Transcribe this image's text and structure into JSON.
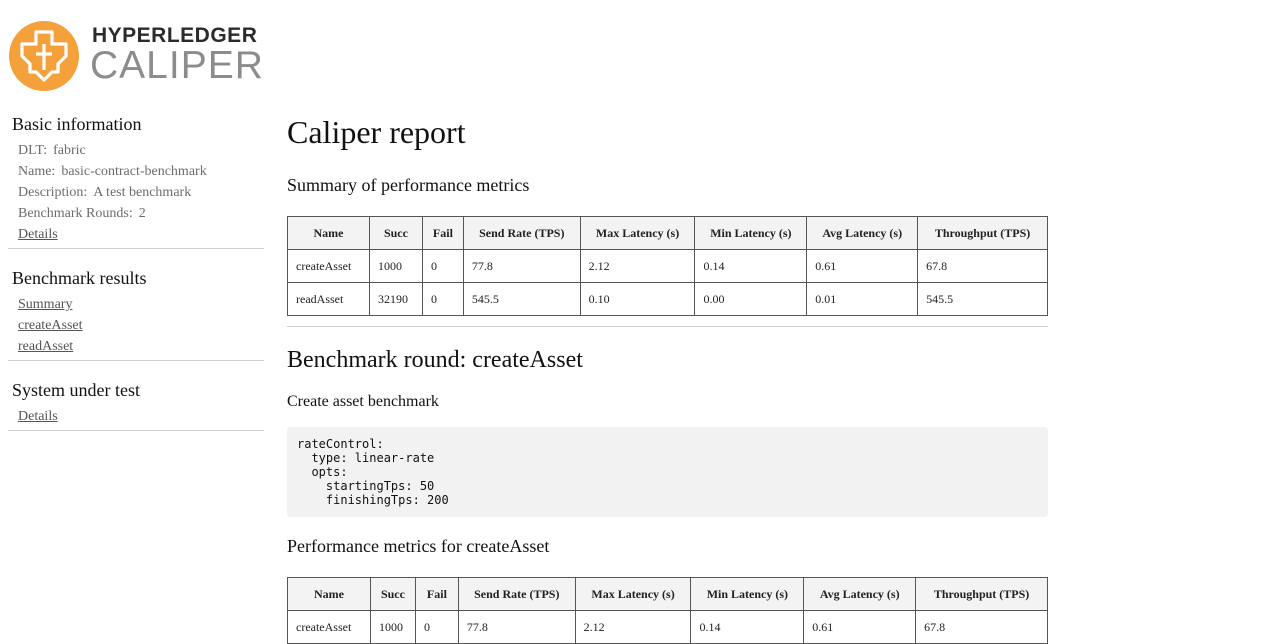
{
  "logo": {
    "top_text": "HYPERLEDGER",
    "bottom_text": "CALIPER",
    "accent": "#f4a03b"
  },
  "sidebar": {
    "basic": {
      "title": "Basic information",
      "dlt_key": "DLT:",
      "dlt_val": "fabric",
      "name_key": "Name:",
      "name_val": "basic-contract-benchmark",
      "desc_key": "Description:",
      "desc_val": "A test benchmark",
      "rounds_key": "Benchmark Rounds:",
      "rounds_val": "2",
      "details_link": "Details"
    },
    "results": {
      "title": "Benchmark results",
      "links": [
        "Summary",
        "createAsset",
        "readAsset"
      ]
    },
    "sut": {
      "title": "System under test",
      "details_link": "Details"
    }
  },
  "main": {
    "title": "Caliper report",
    "summary_heading": "Summary of performance metrics",
    "columns": [
      "Name",
      "Succ",
      "Fail",
      "Send Rate (TPS)",
      "Max Latency (s)",
      "Min Latency (s)",
      "Avg Latency (s)",
      "Throughput (TPS)"
    ],
    "summary_rows": [
      [
        "createAsset",
        "1000",
        "0",
        "77.8",
        "2.12",
        "0.14",
        "0.61",
        "67.8"
      ],
      [
        "readAsset",
        "32190",
        "0",
        "545.5",
        "0.10",
        "0.00",
        "0.01",
        "545.5"
      ]
    ],
    "round_heading": "Benchmark round: createAsset",
    "round_description": "Create asset benchmark",
    "code_lines": [
      "rateControl:",
      "  type: linear-rate",
      "  opts:",
      "    startingTps: 50",
      "    finishingTps: 200"
    ],
    "perf_heading": "Performance metrics for createAsset",
    "perf_rows": [
      [
        "createAsset",
        "1000",
        "0",
        "77.8",
        "2.12",
        "0.14",
        "0.61",
        "67.8"
      ]
    ]
  }
}
